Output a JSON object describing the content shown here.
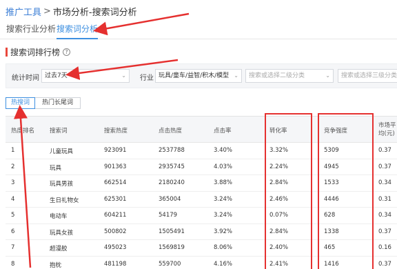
{
  "breadcrumb": {
    "root": "推广工具",
    "sep": ">",
    "current": "市场分析-搜索词分析"
  },
  "tabs": [
    {
      "label": "搜索行业分析",
      "active": false
    },
    {
      "label": "搜索词分析",
      "active": true
    }
  ],
  "section": {
    "title": "搜索词排行榜",
    "help": "?"
  },
  "filters": {
    "period_label": "统计时间",
    "period_value": "过去7天",
    "industry_label": "行业",
    "industry_value": "玩具/童车/益智/积木/模型",
    "level2_placeholder": "搜索或选择二级分类",
    "level3_placeholder": "搜索或选择三级分类"
  },
  "toggle": {
    "hot": "热搜词",
    "longtail": "热门长尾词"
  },
  "table": {
    "headers": [
      "热度排名",
      "搜索词",
      "搜索热度",
      "点击热度",
      "点击率",
      "转化率",
      "竞争强度",
      "市场平均(元)"
    ],
    "rows": [
      {
        "rank": "1",
        "term": "儿童玩具",
        "search_heat": "923091",
        "click_heat": "2537788",
        "ctr": "3.40%",
        "cvr": "3.32%",
        "competition": "5309",
        "avg": "0.37"
      },
      {
        "rank": "2",
        "term": "玩具",
        "search_heat": "901363",
        "click_heat": "2935745",
        "ctr": "4.03%",
        "cvr": "2.24%",
        "competition": "4945",
        "avg": "0.37"
      },
      {
        "rank": "3",
        "term": "玩具男孩",
        "search_heat": "662514",
        "click_heat": "2180240",
        "ctr": "3.88%",
        "cvr": "2.84%",
        "competition": "1533",
        "avg": "0.34"
      },
      {
        "rank": "4",
        "term": "生日礼物女",
        "search_heat": "625301",
        "click_heat": "365004",
        "ctr": "3.24%",
        "cvr": "2.46%",
        "competition": "4446",
        "avg": "0.31"
      },
      {
        "rank": "5",
        "term": "电动车",
        "search_heat": "604211",
        "click_heat": "54179",
        "ctr": "3.24%",
        "cvr": "0.07%",
        "competition": "628",
        "avg": "0.34"
      },
      {
        "rank": "6",
        "term": "玩具女孩",
        "search_heat": "500802",
        "click_heat": "1505491",
        "ctr": "3.92%",
        "cvr": "2.84%",
        "competition": "1338",
        "avg": "0.37"
      },
      {
        "rank": "7",
        "term": "超漫胶",
        "search_heat": "495023",
        "click_heat": "1569819",
        "ctr": "8.06%",
        "cvr": "2.40%",
        "competition": "465",
        "avg": "0.16"
      },
      {
        "rank": "8",
        "term": "抱枕",
        "search_heat": "481198",
        "click_heat": "559700",
        "ctr": "4.16%",
        "cvr": "2.41%",
        "competition": "1416",
        "avg": "0.37"
      }
    ]
  },
  "colors": {
    "accent": "#3d8fe0",
    "link": "#3d7fd6",
    "annotation": "#e5302f",
    "section_bar": "#e8473c"
  }
}
